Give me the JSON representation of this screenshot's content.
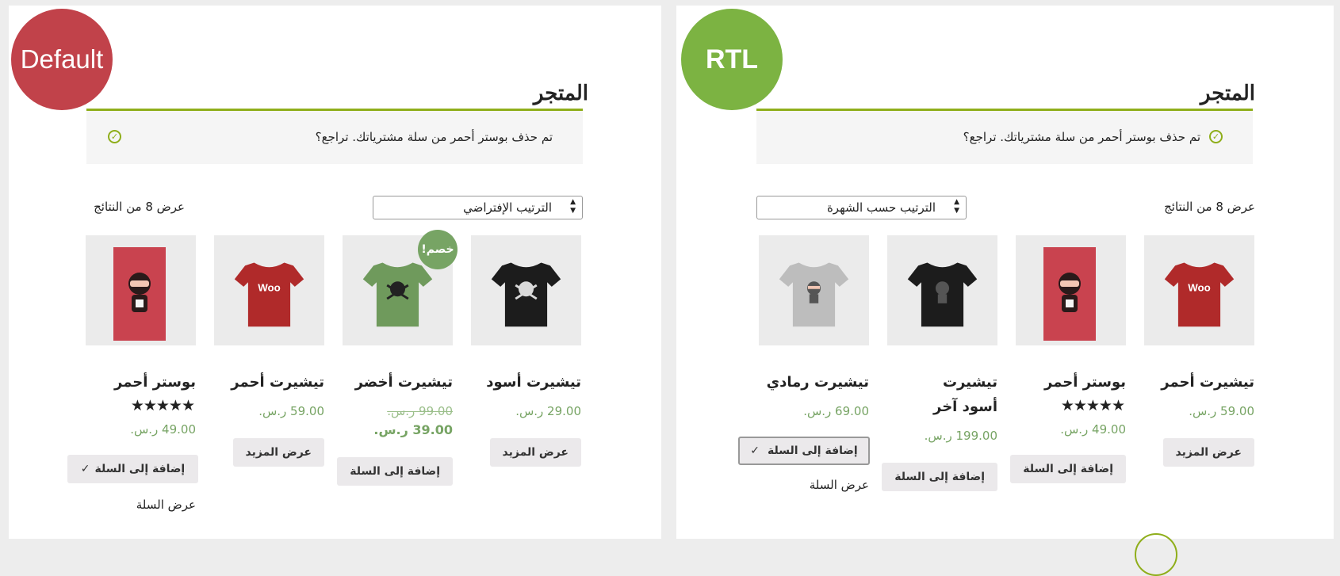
{
  "left": {
    "badge": "Default",
    "title": "المتجر",
    "notice": "تم حذف بوستر أحمر من سلة مشترياتك. تراجع؟",
    "result_count": "عرض 8 من النتائج",
    "orderby": "الترتيب الإفتراضي",
    "products": [
      {
        "name": "تيشيرت أسود",
        "price": "29.00 ر.س.",
        "button": "عرض المزيد",
        "image": "black-tshirt-skull"
      },
      {
        "name": "تيشيرت أخضر",
        "old_price": "99.00 ر.س.",
        "price": "39.00 ر.س.",
        "button": "إضافة إلى السلة",
        "sale": "خصم!",
        "image": "green-tshirt-skull"
      },
      {
        "name": "تيشيرت أحمر",
        "price": "59.00 ر.س.",
        "button": "عرض المزيد",
        "image": "red-tshirt-woo"
      },
      {
        "name": "بوستر أحمر",
        "stars": "★★★★★",
        "rating": 5,
        "price": "49.00 ر.س.",
        "button": "إضافة إلى السلة",
        "view_cart": "عرض السلة",
        "image": "red-poster-ninja"
      }
    ]
  },
  "right": {
    "badge": "RTL",
    "title": "المتجر",
    "notice": "تم حذف بوستر أحمر من سلة مشترياتك. تراجع؟",
    "result_count": "عرض 8 من النتائج",
    "orderby": "الترتيب حسب الشهرة",
    "products": [
      {
        "name": "تيشيرت أحمر",
        "price": "59.00 ر.س.",
        "button": "عرض المزيد",
        "image": "red-tshirt-woo"
      },
      {
        "name": "بوستر أحمر",
        "stars": "★★★★★",
        "rating": 5,
        "price": "49.00 ر.س.",
        "button": "إضافة إلى السلة",
        "image": "red-poster-ninja"
      },
      {
        "name": "تيشيرت أسود آخر",
        "price": "199.00 ر.س.",
        "button": "إضافة إلى السلة",
        "image": "black-tshirt-ninja"
      },
      {
        "name": "تيشيرت رمادي",
        "price": "69.00 ر.س.",
        "button": "إضافة إلى السلة",
        "view_cart": "عرض السلة",
        "image": "grey-tshirt-ninja"
      }
    ]
  },
  "colors": {
    "default_badge": "#c1424a",
    "rtl_badge": "#7cb342",
    "accent": "#8fae1b",
    "price": "#77a464"
  },
  "icons": {
    "notice": "check-circle-icon",
    "added": "checkmark-icon",
    "sort": "sort-arrows-icon"
  }
}
